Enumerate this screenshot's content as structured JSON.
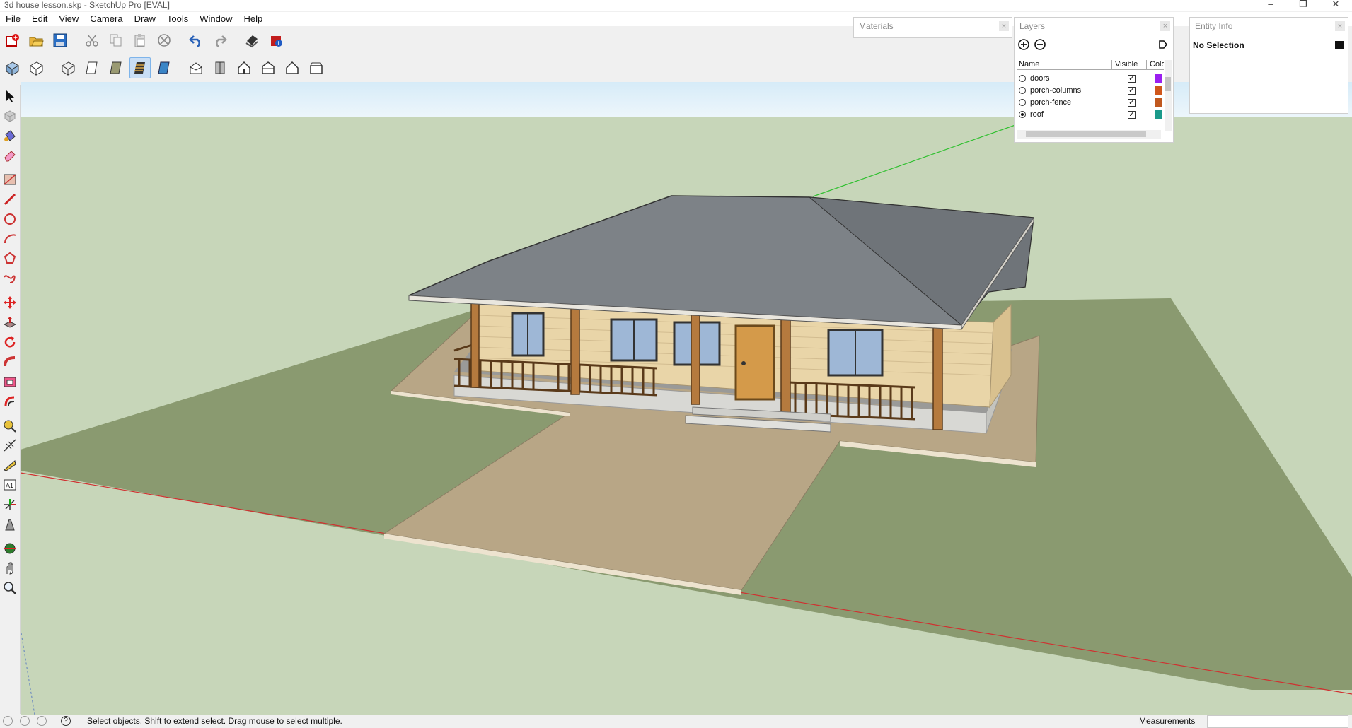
{
  "window": {
    "title": "3d house lesson.skp - SketchUp Pro [EVAL]",
    "minimize": "–",
    "restore": "❒",
    "close": "✕"
  },
  "menu": [
    "File",
    "Edit",
    "View",
    "Camera",
    "Draw",
    "Tools",
    "Window",
    "Help"
  ],
  "toolbar_icons": {
    "top": [
      "new-icon",
      "open-icon",
      "save-icon",
      "cut-icon",
      "copy-icon",
      "paste-icon",
      "erase-icon",
      "undo-icon",
      "redo-icon",
      "print-icon",
      "model-info-icon"
    ],
    "styles": [
      "xray-icon",
      "back-edges-icon",
      "wireframe-icon",
      "hidden-line-icon",
      "shaded-icon",
      "shaded-with-textures-icon",
      "monochrome-icon",
      "iso-view-icon",
      "top-view-icon",
      "front-view-icon",
      "right-view-icon",
      "back-view-icon",
      "left-view-icon"
    ],
    "left": [
      "select-icon",
      "make-component-icon",
      "paint-bucket-icon",
      "eraser-icon",
      "rectangle-icon",
      "line-icon",
      "circle-icon",
      "arc-icon",
      "polygon-icon",
      "freehand-icon",
      "move-icon",
      "push-pull-icon",
      "rotate-icon",
      "follow-me-icon",
      "scale-icon",
      "offset-icon",
      "tape-measure-icon",
      "dimension-icon",
      "protractor-icon",
      "text-icon",
      "axes-icon",
      "3d-text-icon",
      "orbit-icon",
      "pan-icon",
      "zoom-icon"
    ]
  },
  "panels": {
    "materials": {
      "title": "Materials"
    },
    "layers": {
      "title": "Layers",
      "col_name": "Name",
      "col_visible": "Visible",
      "col_color": "Colo",
      "rows": [
        {
          "name": "doors",
          "active": false,
          "visible": true,
          "color": "#9b1ff0"
        },
        {
          "name": "porch-columns",
          "active": false,
          "visible": true,
          "color": "#d0561a"
        },
        {
          "name": "porch-fence",
          "active": false,
          "visible": true,
          "color": "#c0581e"
        },
        {
          "name": "roof",
          "active": true,
          "visible": true,
          "color": "#1a9a8a"
        }
      ],
      "check_mark": "✓"
    },
    "entity_info": {
      "title": "Entity Info",
      "selection": "No Selection"
    }
  },
  "status": {
    "hint": "Select objects. Shift to extend select. Drag mouse to select multiple.",
    "measurements_label": "Measurements",
    "measurements_value": ""
  },
  "colors": {
    "sky": "#e6f2fa",
    "ground": "#8a9a70",
    "roof": "#7d8287",
    "wall": "#e9d5a8",
    "walkway": "#b8a686"
  }
}
